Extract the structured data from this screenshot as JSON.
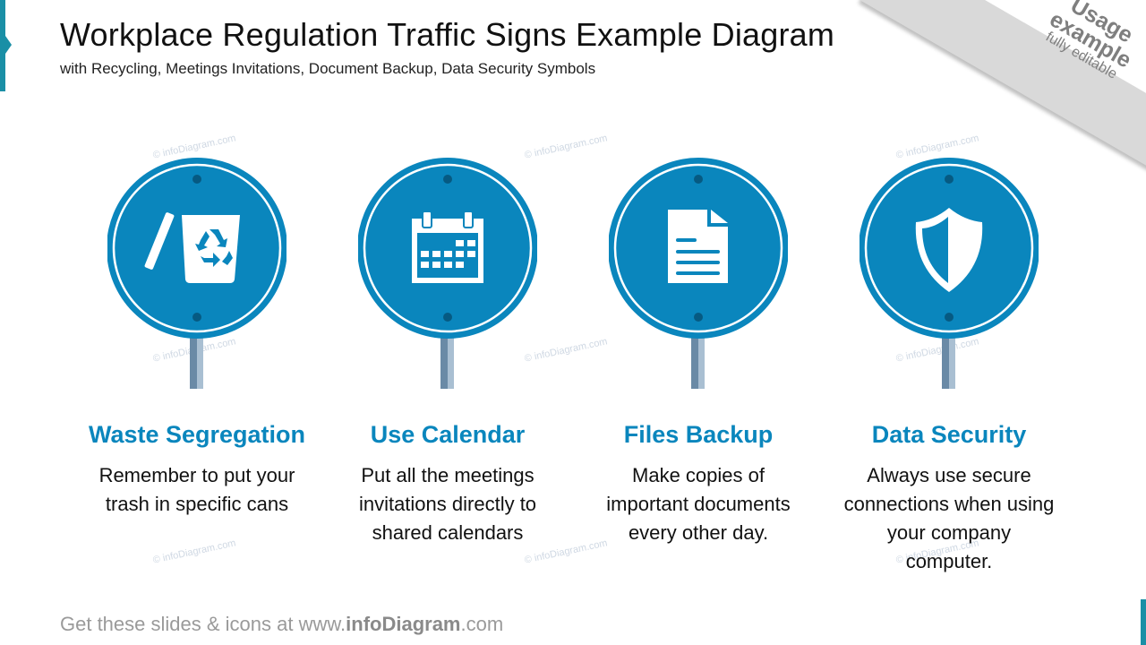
{
  "header": {
    "title": "Workplace Regulation Traffic Signs Example Diagram",
    "subtitle": "with Recycling, Meetings Invitations, Document Backup, Data Security Symbols"
  },
  "ribbon": {
    "line1": "Usage",
    "line2": "example",
    "line3": "fully editable"
  },
  "watermark": "© infoDiagram.com",
  "colors": {
    "sign_blue": "#0a86bd",
    "bolt": "#065a82",
    "pole_dark": "#6a8aa6",
    "pole_light": "#a9bfd2",
    "accent": "#1a8fa6"
  },
  "signs": [
    {
      "icon": "recycle-bin-icon",
      "title": "Waste Segregation",
      "lines": [
        "Remember to put your",
        "trash in specific cans"
      ]
    },
    {
      "icon": "calendar-icon",
      "title": "Use Calendar",
      "lines": [
        "Put all the meetings",
        "invitations directly to",
        "shared calendars"
      ]
    },
    {
      "icon": "document-icon",
      "title": "Files Backup",
      "lines": [
        "Make copies of",
        "important documents",
        "every other day."
      ]
    },
    {
      "icon": "shield-icon",
      "title": "Data Security",
      "lines": [
        "Always use secure",
        "connections when using",
        "your company",
        "computer."
      ]
    }
  ],
  "footer": {
    "prefix": "Get these slides & icons at www.",
    "brand": "infoDiagram",
    "suffix": ".com"
  }
}
